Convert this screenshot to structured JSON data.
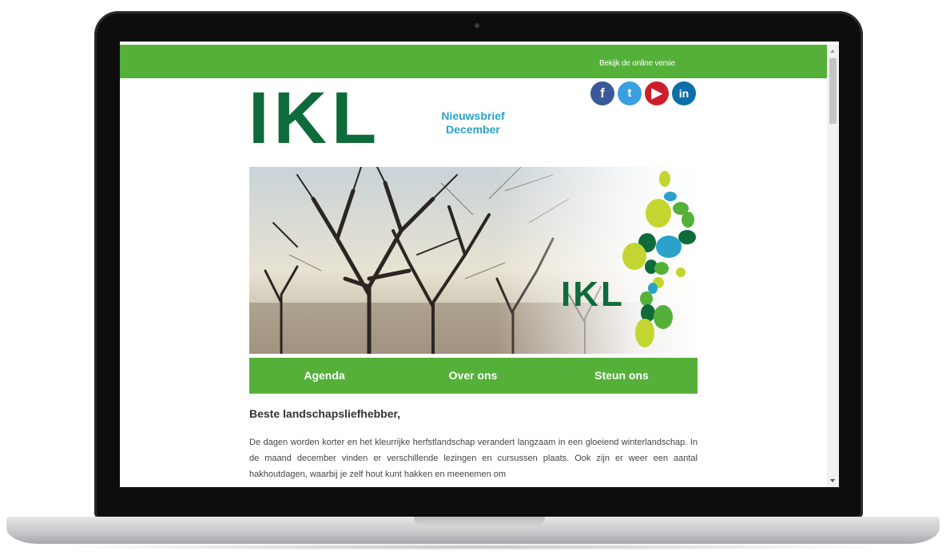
{
  "topbar": {
    "online_link": "Bekijk de online versie"
  },
  "header": {
    "logo_text": "IKL",
    "newsletter_title": "Nieuwsbrief",
    "newsletter_month": "December"
  },
  "social": {
    "facebook_glyph": "f",
    "twitter_glyph": "t",
    "youtube_glyph": "▶",
    "linkedin_glyph": "in"
  },
  "hero": {
    "logo_text": "IKL"
  },
  "nav": {
    "items": [
      "Agenda",
      "Over ons",
      "Steun ons"
    ]
  },
  "content": {
    "greeting": "Beste landschapsliefhebber,",
    "paragraph": "De dagen worden korter en het kleurrijke herfstlandschap verandert langzaam in een gloeiend winterlandschap. In de maand december vinden er verschillende lezingen en cursussen plaats. Ook zijn er weer een aantal hakhoutdagen, waarbij je zelf hout kunt hakken en meenemen om"
  },
  "colors": {
    "brand_green": "#55b03a",
    "logo_dark_green": "#0f6b3b",
    "title_blue": "#2aa2c9"
  }
}
